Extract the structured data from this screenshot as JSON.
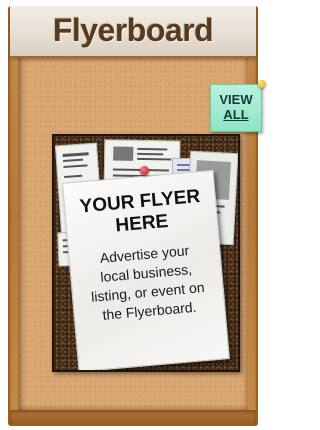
{
  "header": {
    "title": "Flyerboard"
  },
  "view_all": {
    "line1": "VIEW",
    "line2": "ALL"
  },
  "main_flyer": {
    "title_line1": "YOUR FLYER",
    "title_line2": "HERE",
    "body_line1": "Advertise your",
    "body_line2": "local business,",
    "body_line3": "listing, or event on",
    "body_line4": "the Flyerboard."
  },
  "colors": {
    "frame": "#b6793a",
    "header_bg": "#e7dfd3",
    "header_text": "#5a3a1c",
    "view_all_bg": "#8fe4c4",
    "cork": "#3a2616"
  },
  "icons": {
    "push_pin": "push-pin-icon",
    "corner_pin": "pin-icon"
  }
}
